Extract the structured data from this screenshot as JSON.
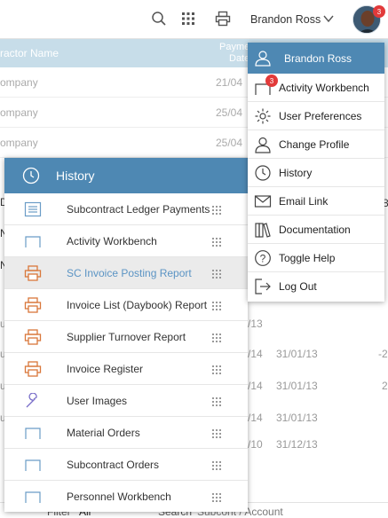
{
  "topbar": {
    "user_name": "Brandon Ross",
    "avatar_badge": "3",
    "icons": [
      "search-icon",
      "apps-grid-icon",
      "print-icon",
      "chevron-down-icon"
    ]
  },
  "table": {
    "headers": [
      "ractor Name",
      "Payme",
      "Date"
    ],
    "rows": [
      {
        "name": "ompany",
        "date": "21/04"
      },
      {
        "name": "ompany",
        "date": "25/04"
      },
      {
        "name": "ompany",
        "date": "25/04"
      }
    ],
    "background_fragments": [
      "D",
      "N",
      "N",
      "ul",
      "ul",
      "ul",
      "ul",
      "8",
      "/13",
      "/14",
      "31/01/13",
      "-2",
      "/14",
      "31/01/13",
      "2",
      "/14",
      "31/01/13",
      "/10",
      "31/12/13"
    ]
  },
  "filter_bar": {
    "filter_label": "Filter",
    "filter_value": "All",
    "search_label": "Search",
    "search_value": "Subcont / Account"
  },
  "history": {
    "title": "History",
    "items": [
      {
        "label": "Subcontract Ledger Payments",
        "icon": "ledger-list-icon"
      },
      {
        "label": "Activity Workbench",
        "icon": "workbench-icon"
      },
      {
        "label": "SC Invoice Posting Report",
        "icon": "printer-report-icon",
        "selected": true
      },
      {
        "label": "Invoice List (Daybook) Report",
        "icon": "printer-report-icon"
      },
      {
        "label": "Supplier Turnover Report",
        "icon": "printer-report-icon"
      },
      {
        "label": "Invoice Register",
        "icon": "printer-report-icon"
      },
      {
        "label": "User Images",
        "icon": "wrench-icon"
      },
      {
        "label": "Material Orders",
        "icon": "workbench-icon"
      },
      {
        "label": "Subcontract Orders",
        "icon": "workbench-icon"
      },
      {
        "label": "Personnel Workbench",
        "icon": "workbench-icon"
      }
    ]
  },
  "user_menu": {
    "title": "Brandon Ross",
    "items": [
      {
        "label": "Activity Workbench",
        "icon": "workbench-icon",
        "badge": "3"
      },
      {
        "label": "User Preferences",
        "icon": "gear-icon"
      },
      {
        "label": "Change Profile",
        "icon": "user-icon"
      },
      {
        "label": "History",
        "icon": "clock-icon"
      },
      {
        "label": "Email Link",
        "icon": "envelope-icon"
      },
      {
        "label": "Documentation",
        "icon": "books-icon"
      },
      {
        "label": "Toggle Help",
        "icon": "help-icon"
      },
      {
        "label": "Log Out",
        "icon": "logout-icon"
      }
    ]
  },
  "colors": {
    "header_blue": "#4e88b3",
    "table_header": "#c7dde9",
    "report_orange": "#d9773a",
    "link_blue": "#5b94c4",
    "badge_red": "#e23a3a"
  }
}
